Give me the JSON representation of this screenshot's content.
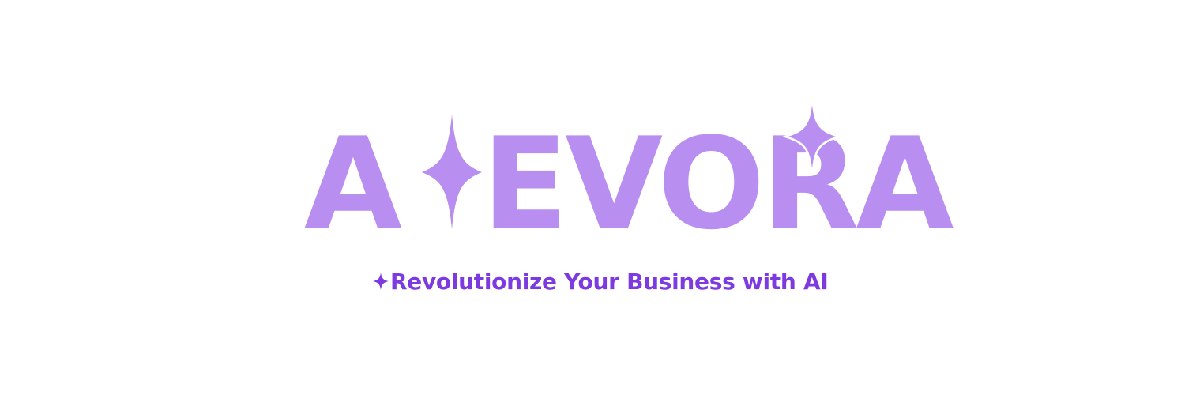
{
  "brand": {
    "name": "AIEVORA",
    "name_before_sparkle": "A",
    "name_after_sparkle": "EVORA",
    "logo_color": "#b88ef0",
    "sparkle_icon": "sparkle-icon"
  },
  "tagline": {
    "text": "Revolutionize Your Business with AI",
    "color": "#7c3ae0",
    "icon": "sparkle-icon"
  },
  "background_color": "#ffffff"
}
